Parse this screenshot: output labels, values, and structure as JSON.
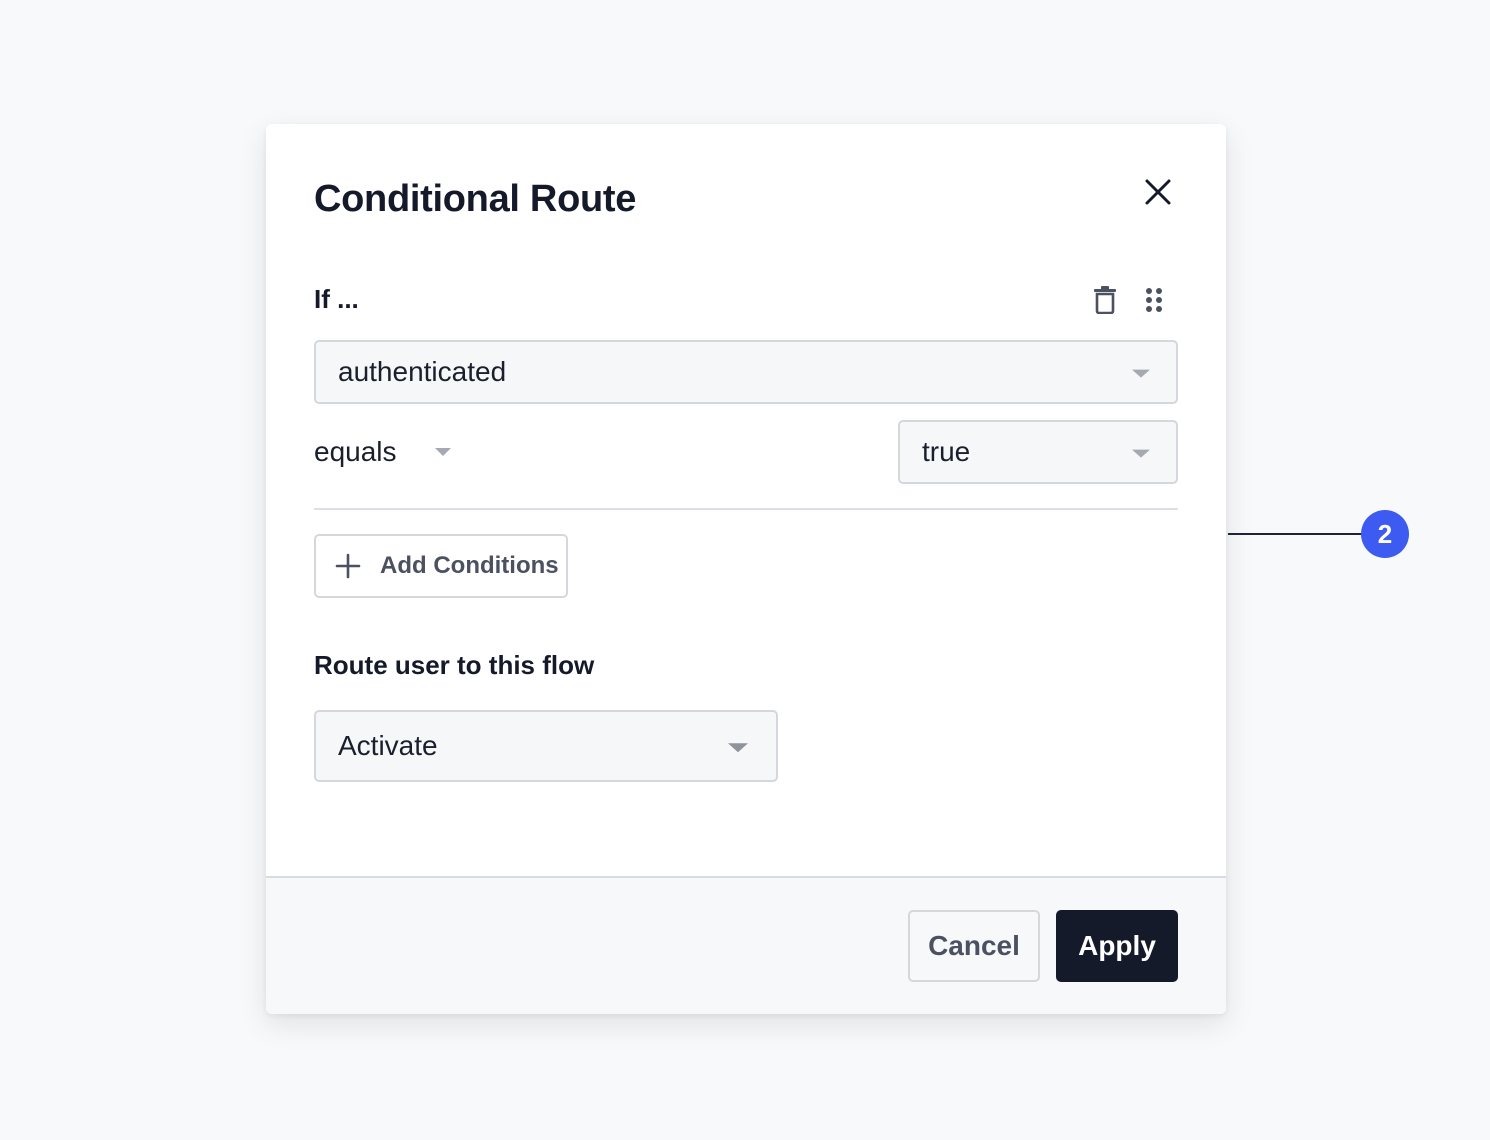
{
  "modal": {
    "title": "Conditional Route",
    "close_icon": "close-icon"
  },
  "condition": {
    "label": "If ...",
    "field": {
      "value": "authenticated"
    },
    "operator": {
      "value": "equals"
    },
    "value": {
      "value": "true"
    },
    "icons": [
      "trash-icon",
      "drag-handle-icon"
    ]
  },
  "add_conditions": {
    "label": "Add Conditions",
    "icon": "plus-icon"
  },
  "route": {
    "label": "Route user to this flow",
    "flow": {
      "value": "Activate"
    }
  },
  "footer": {
    "cancel_label": "Cancel",
    "apply_label": "Apply"
  },
  "callout": {
    "number": "2",
    "color": "#3d5af1"
  },
  "colors": {
    "primary_dark": "#151a2b",
    "accent": "#3d5af1",
    "background": "#f8f9fa"
  }
}
